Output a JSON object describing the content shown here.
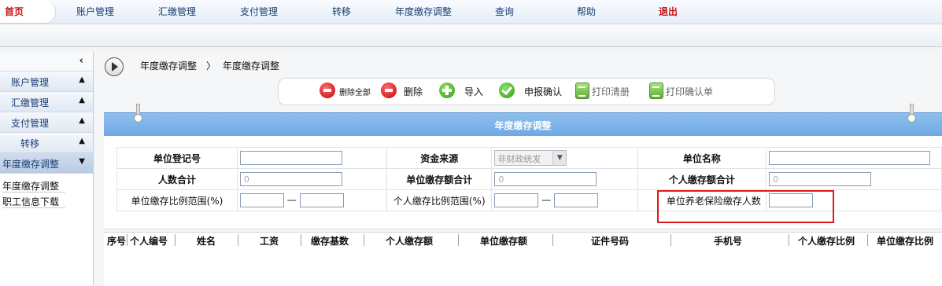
{
  "topnav": {
    "items": [
      "首页",
      "账户管理",
      "汇缴管理",
      "支付管理",
      "转移",
      "年度缴存调整",
      "查询",
      "帮助",
      "退出"
    ]
  },
  "sidebar": {
    "collapse_icon": "chevron-left",
    "groups": [
      "账户管理",
      "汇缴管理",
      "支付管理",
      "转移",
      "年度缴存调整"
    ],
    "sub_items": [
      "年度缴存调整",
      "职工信息下载"
    ]
  },
  "breadcrumb": {
    "parent": "年度缴存调整",
    "separator": "〉",
    "current": "年度缴存调整"
  },
  "toolbar": {
    "delete_all": "删除全部",
    "delete": "删除",
    "import": "导入",
    "confirm": "申报确认",
    "print_list": "打印清册",
    "print_confirm": "打印确认单"
  },
  "section": {
    "title": "年度缴存调整"
  },
  "form": {
    "unit_reg_no_label": "单位登记号",
    "unit_reg_no_value": "",
    "fund_source_label": "资金来源",
    "fund_source_value": "非财政统发",
    "unit_name_label": "单位名称",
    "unit_name_value": "",
    "total_people_label": "人数合计",
    "total_people_value": "0",
    "unit_deposit_total_label": "单位缴存额合计",
    "unit_deposit_total_value": "0",
    "personal_deposit_total_label": "个人缴存额合计",
    "personal_deposit_total_value": "0",
    "unit_ratio_range_label": "单位缴存比例范围(%)",
    "personal_ratio_range_label": "个人缴存比例范围(%)",
    "range_dash": "—",
    "pension_count_label": "单位养老保险缴存人数",
    "pension_count_value": ""
  },
  "grid": {
    "columns": [
      "序号",
      "个人编号",
      "姓名",
      "工资",
      "缴存基数",
      "个人缴存额",
      "单位缴存额",
      "证件号码",
      "手机号",
      "个人缴存比例",
      "单位缴存比例"
    ]
  },
  "colors": {
    "accent": "#6ea8e3",
    "danger": "#cc1111",
    "highlight_border": "#e01a1a"
  }
}
